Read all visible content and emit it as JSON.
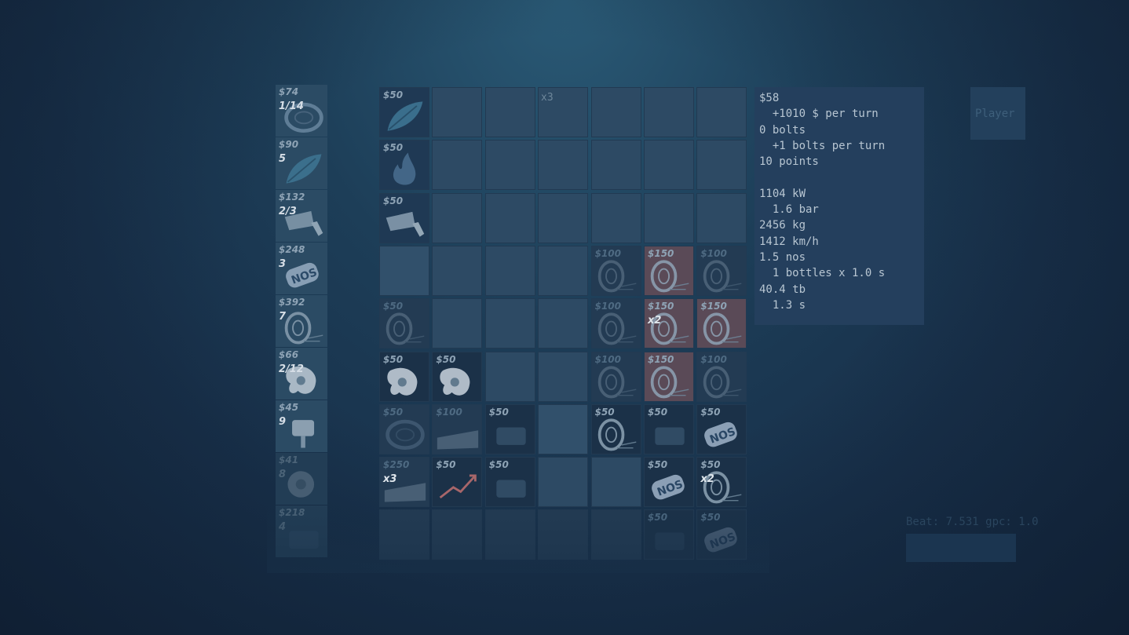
{
  "shop": [
    {
      "price": "$74",
      "stock": "1/14",
      "icon": "tire-icon"
    },
    {
      "price": "$90",
      "stock": "5",
      "icon": "feather-icon"
    },
    {
      "price": "$132",
      "stock": "2/3",
      "icon": "exhaust-pipe-icon"
    },
    {
      "price": "$248",
      "stock": "3",
      "icon": "nos-bottle-icon"
    },
    {
      "price": "$392",
      "stock": "7",
      "icon": "wheel-icon"
    },
    {
      "price": "$66",
      "stock": "2/12",
      "icon": "turbo-icon"
    },
    {
      "price": "$45",
      "stock": "9",
      "icon": "piston-icon"
    },
    {
      "price": "$41",
      "stock": "8",
      "icon": "engine-icon"
    },
    {
      "price": "$218",
      "stock": "4",
      "icon": "part-icon"
    }
  ],
  "board": {
    "top_multiplier": "x3",
    "cells": [
      {
        "price": "$50",
        "icon": "feather-icon"
      },
      {
        "price": "$50",
        "icon": "flame-icon"
      },
      {
        "price": "$50",
        "icon": "exhaust-pipe-icon"
      },
      {
        "price": "$100",
        "icon": "wheel-icon"
      },
      {
        "price": "$150",
        "icon": "wheel-icon"
      },
      {
        "price": "$100",
        "icon": "wheel-icon"
      },
      {
        "price": "$50",
        "icon": "wheel-icon"
      },
      {
        "price": "$100",
        "icon": "wheel-icon"
      },
      {
        "price": "$150",
        "mult": "x2",
        "icon": "wheel-icon"
      },
      {
        "price": "$150",
        "icon": "wheel-icon"
      },
      {
        "price": "$50",
        "icon": "turbo-icon"
      },
      {
        "price": "$50",
        "icon": "turbo-icon"
      },
      {
        "price": "$100",
        "icon": "wheel-icon"
      },
      {
        "price": "$150",
        "icon": "wheel-icon"
      },
      {
        "price": "$100",
        "icon": "wheel-icon"
      },
      {
        "price": "$50",
        "icon": "tire-icon"
      },
      {
        "price": "$100",
        "icon": "spoiler-icon"
      },
      {
        "price": "$50",
        "icon": "part-icon"
      },
      {
        "price": "$50",
        "icon": "wheel-icon"
      },
      {
        "price": "$50",
        "icon": "part-icon"
      },
      {
        "price": "$50",
        "icon": "nos-bottle-icon"
      },
      {
        "price": "$250",
        "mult": "x3",
        "icon": "spoiler-icon"
      },
      {
        "price": "$50",
        "icon": "chart-up-icon"
      },
      {
        "price": "$50",
        "icon": "part-icon"
      },
      {
        "price": "$50",
        "icon": "nos-bottle-icon"
      },
      {
        "price": "$50",
        "mult": "x2",
        "icon": "wheel-icon"
      },
      {
        "price": "$50",
        "icon": "part-icon"
      },
      {
        "price": "$50",
        "icon": "nos-bottle-icon"
      }
    ]
  },
  "stats": {
    "lines": [
      "$58",
      "  +1010 $ per turn",
      "0 bolts",
      "  +1 bolts per turn",
      "10 points",
      "",
      "1104 kW",
      "  1.6 bar",
      "2456 kg",
      "1412 km/h",
      "1.5 nos",
      "  1 bottles x 1.0 s",
      "40.4 tb",
      "  1.3 s"
    ]
  },
  "player_label": "Player",
  "beat_text": "Beat: 7.531 gpc: 1.0"
}
